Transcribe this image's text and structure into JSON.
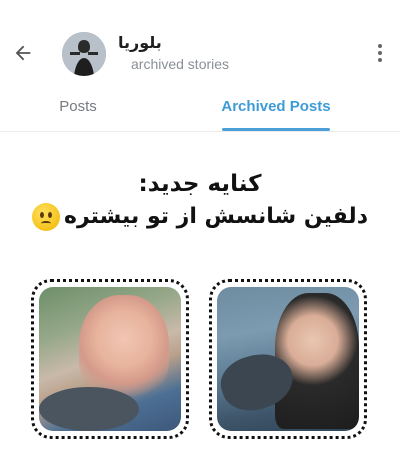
{
  "header": {
    "back_icon": "arrow-left-icon",
    "title": "ﺑﻠﻮﺭﻳﺎ",
    "subtitle": "archived stories",
    "menu_icon": "more-vertical-icon"
  },
  "tabs": [
    {
      "label": "Posts",
      "active": false
    },
    {
      "label": "Archived Posts",
      "active": true
    }
  ],
  "post": {
    "line1": "کنایه جدید:",
    "line2": "دلفین شانسش از تو بیشتره",
    "emoji": "worried-face-emoji",
    "images": [
      {
        "name": "photo-left"
      },
      {
        "name": "photo-right"
      }
    ]
  },
  "colors": {
    "accent": "#3f9bd8",
    "tab_inactive": "#767b82",
    "subtitle": "#8a8f96"
  }
}
